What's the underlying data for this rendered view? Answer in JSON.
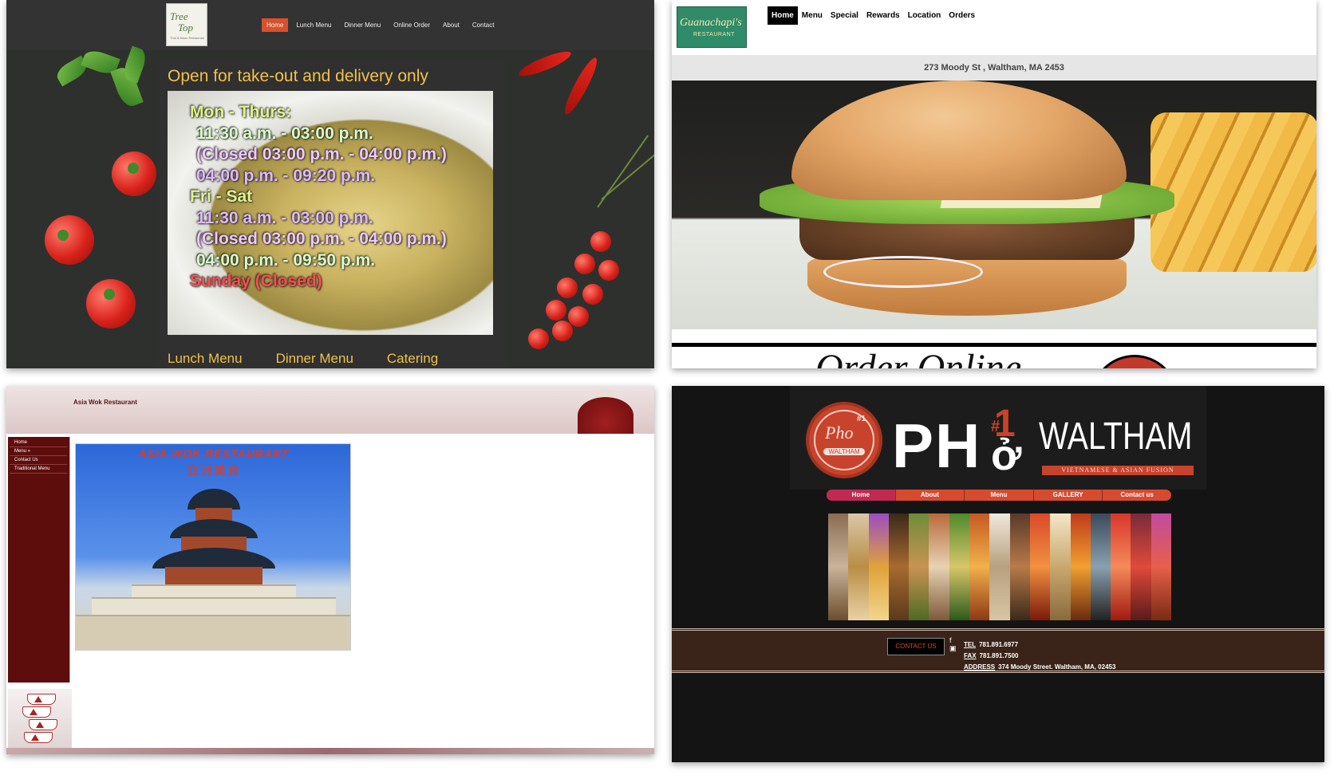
{
  "panel1": {
    "logo": {
      "line1": "Tree",
      "line2": "Top",
      "line3": "Thai & Asian Restaurant"
    },
    "nav": [
      "Home",
      "Lunch Menu",
      "Dinner Menu",
      "Online Order",
      "About",
      "Contact"
    ],
    "active_nav": "Home",
    "headline": "Open for take-out and delivery only",
    "hours": {
      "weekday_label": "Mon - Thurs:",
      "weekday_lunch": "11:30 a.m. - 03:00 p.m.",
      "weekday_closed": "(Closed 03:00 p.m. - 04:00 p.m.)",
      "weekday_dinner": "04:00 p.m. - 09:20 p.m.",
      "weekend_label": "Fri - Sat",
      "weekend_lunch": "11:30 a.m. - 03:00 p.m.",
      "weekend_closed": "(Closed 03:00 p.m. - 04:00 p.m.)",
      "weekend_dinner": "04:00 p.m. - 09:50 p.m.",
      "sunday": "Sunday (Closed)"
    },
    "bottom_links": [
      "Lunch Menu",
      "Dinner Menu",
      "Catering"
    ],
    "colors": {
      "accent": "#d9502d",
      "headline": "#f3c04c"
    }
  },
  "panel2": {
    "logo": {
      "name": "Guanachapi's",
      "sub": "RESTAURANT"
    },
    "nav": [
      "Home",
      "Menu",
      "Special",
      "Rewards",
      "Location",
      "Orders"
    ],
    "active_nav": "Home",
    "address": "273 Moody St , Waltham, MA 2453",
    "slider_dots": 3,
    "slider_active": 1,
    "order_peek": "Order Online"
  },
  "panel3": {
    "title": "Asia Wok Restaurant",
    "menu": [
      "Home",
      "Menu »",
      "Contact Us",
      "Traditional Menu"
    ],
    "photo_title_en": "ASIA WOK RESTAURANT",
    "photo_title_cn": "亚洲美食"
  },
  "panel4": {
    "badge": {
      "script": "Pho",
      "city": "WALTHAM",
      "num": "#1"
    },
    "brand": {
      "ph": "PH",
      "hash": "#",
      "num": "1",
      "diacritic": "ở",
      "city": "WALTHAM",
      "tagline": "VIETNAMESE & ASIAN FUSION"
    },
    "nav": [
      "Home",
      "About",
      "Menu",
      "GALLERY",
      "Contact us"
    ],
    "active_nav": "Home",
    "contact_button": "CONTACT US",
    "tel_label": "TEL",
    "tel": "781.891.6977",
    "fax_label": "FAX",
    "fax": "781.891.7500",
    "address_label": "ADDRESS",
    "address": "374 Moody Street. Waltham, MA, 02453",
    "colors": {
      "brand_red": "#c8432b",
      "nav_active": "#c02a50"
    }
  }
}
